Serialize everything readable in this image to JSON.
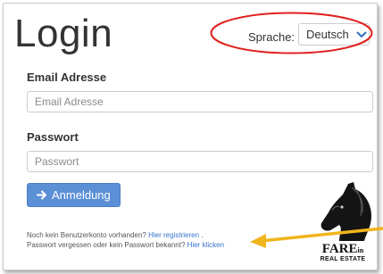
{
  "login": {
    "title": "Login",
    "language_label": "Sprache:",
    "language_value": "Deutsch",
    "email_label": "Email Adresse",
    "email_placeholder": "Email Adresse",
    "email_value": "",
    "password_label": "Passwort",
    "password_placeholder": "Passwort",
    "password_value": "",
    "submit_label": "Anmeldung",
    "register_prompt": "Noch kein Benutzerkonto vorhanden?",
    "register_link": "Hier registrieren",
    "register_after": " .",
    "forgot_prompt": "Passwort vergessen oder kein Passwort bekannt?",
    "forgot_link": "Hier klicken"
  },
  "logo": {
    "name": "FARE",
    "name_suffix": "in",
    "subtitle": "REAL ESTATE"
  },
  "icons": {
    "submit": "arrow-right-icon",
    "dropdown": "chevron-down-icon",
    "logo": "horse-head-icon"
  },
  "colors": {
    "accent": "#5b8fd6",
    "link": "#3572c9",
    "highlight_ellipse": "#e0201c",
    "annotation_arrow": "#f0b41c"
  }
}
